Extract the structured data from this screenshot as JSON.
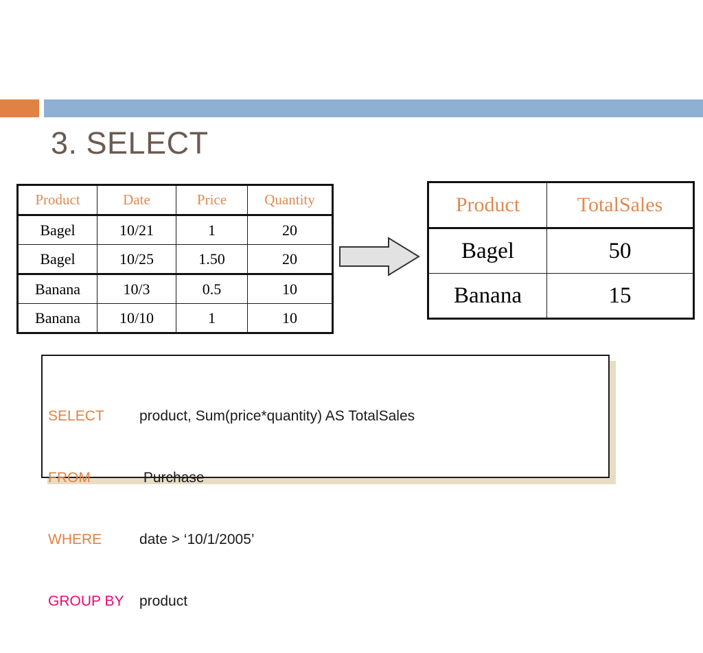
{
  "slide": {
    "title": "3. SELECT",
    "accent_color": "#df8244",
    "rule_color": "#8fb0d3",
    "title_color": "#6b5b52"
  },
  "source_table": {
    "headers": [
      "Product",
      "Date",
      "Price",
      "Quantity"
    ],
    "header_color": "#e08a4e",
    "rows": [
      {
        "product": "Bagel",
        "date": "10/21",
        "price": "1",
        "quantity": "20"
      },
      {
        "product": "Bagel",
        "date": "10/25",
        "price": "1.50",
        "quantity": "20"
      },
      {
        "product": "Banana",
        "date": "10/3",
        "price": "0.5",
        "quantity": "10"
      },
      {
        "product": "Banana",
        "date": "10/10",
        "price": "1",
        "quantity": "10"
      }
    ]
  },
  "arrow": {
    "icon": "right-block-arrow-icon",
    "fill_color": "#e2e2e2",
    "stroke_color": "#333333"
  },
  "result_table": {
    "headers": [
      "Product",
      "TotalSales"
    ],
    "header_color": "#e08a4e",
    "rows": [
      {
        "product": "Bagel",
        "totalsales": "50"
      },
      {
        "product": "Banana",
        "totalsales": "15"
      }
    ]
  },
  "sql": {
    "shadow_color": "#e8dcc3",
    "keyword_color": "#e2823f",
    "groupby_color": "#ec0a70",
    "lines": [
      {
        "keyword": "SELECT",
        "body": "product, Sum(price*quantity) AS TotalSales"
      },
      {
        "keyword": "FROM",
        "body": " Purchase"
      },
      {
        "keyword": "WHERE",
        "body": "date > ‘10/1/2005’"
      },
      {
        "keyword": "GROUP BY",
        "body": "product"
      }
    ]
  }
}
